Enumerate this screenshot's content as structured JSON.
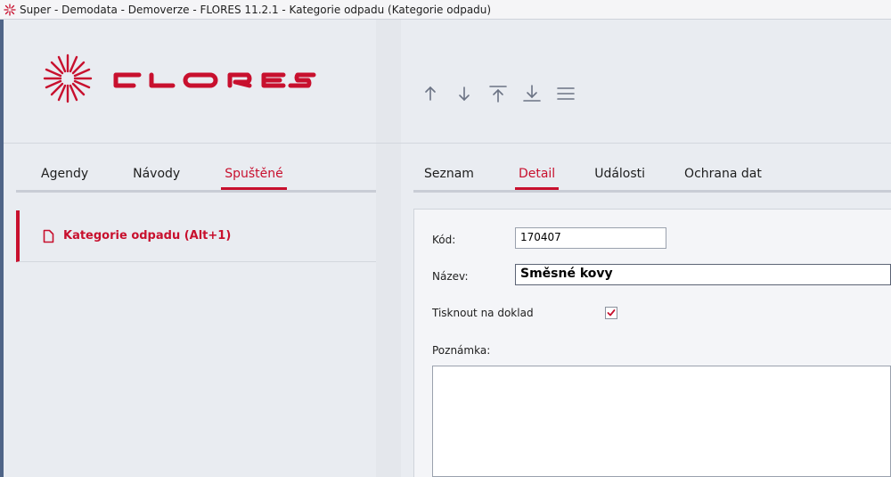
{
  "window": {
    "title": "Super - Demodata - Demoverze - FLORES 11.2.1 - Kategorie odpadu  (Kategorie odpadu)"
  },
  "logo": {
    "text": "FLORES"
  },
  "colors": {
    "accent": "#c8102e",
    "frame": "#4f6487",
    "panel": "#e9ecf1"
  },
  "toolbar": {
    "buttons": [
      {
        "name": "move-up",
        "icon": "arrow-up-icon"
      },
      {
        "name": "move-down",
        "icon": "arrow-down-icon"
      },
      {
        "name": "move-top",
        "icon": "arrow-to-top-icon"
      },
      {
        "name": "move-bottom",
        "icon": "arrow-to-bottom-icon"
      },
      {
        "name": "menu",
        "icon": "menu-icon"
      }
    ]
  },
  "left_tabs": [
    {
      "label": "Agendy",
      "active": false
    },
    {
      "label": "Návody",
      "active": false
    },
    {
      "label": "Spuštěné",
      "active": true
    }
  ],
  "open_items": [
    {
      "label": "Kategorie odpadu (Alt+1)",
      "icon": "document-icon"
    }
  ],
  "right_tabs": [
    {
      "label": "Seznam",
      "active": false
    },
    {
      "label": "Detail",
      "active": true
    },
    {
      "label": "Události",
      "active": false
    },
    {
      "label": "Ochrana dat",
      "active": false
    }
  ],
  "form": {
    "kod_label": "Kód:",
    "kod_value": "170407",
    "nazev_label": "Název:",
    "nazev_value": "Směsné kovy",
    "tisk_label": "Tisknout na doklad",
    "tisk_checked": true,
    "poznamka_label": "Poznámka:",
    "poznamka_value": ""
  }
}
